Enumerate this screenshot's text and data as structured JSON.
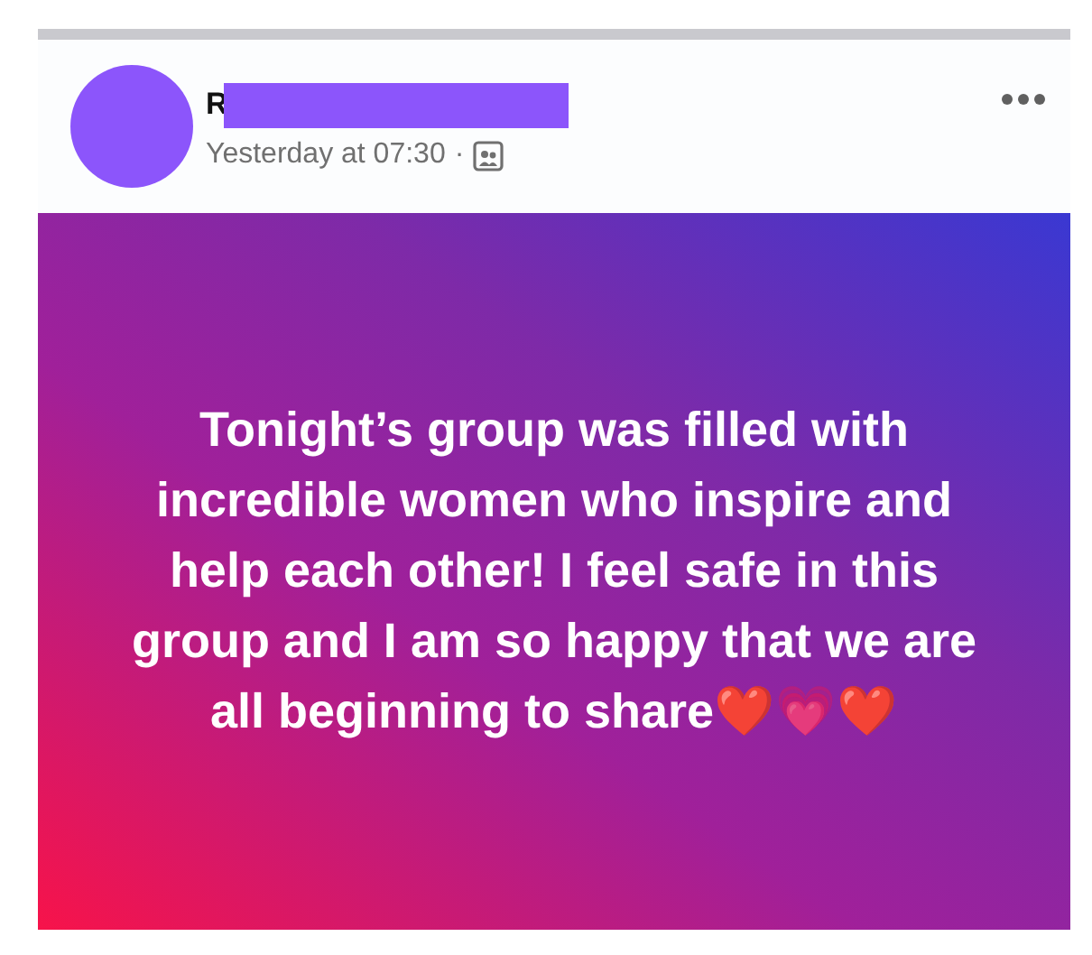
{
  "post": {
    "author": "R",
    "time": "Yesterday at 07:30",
    "separator": "·",
    "body": "Tonight’s group was filled with incredible women who inspire and help each other! I feel safe in this group and I am so happy that we are all beginning to share❤️💗❤️"
  }
}
